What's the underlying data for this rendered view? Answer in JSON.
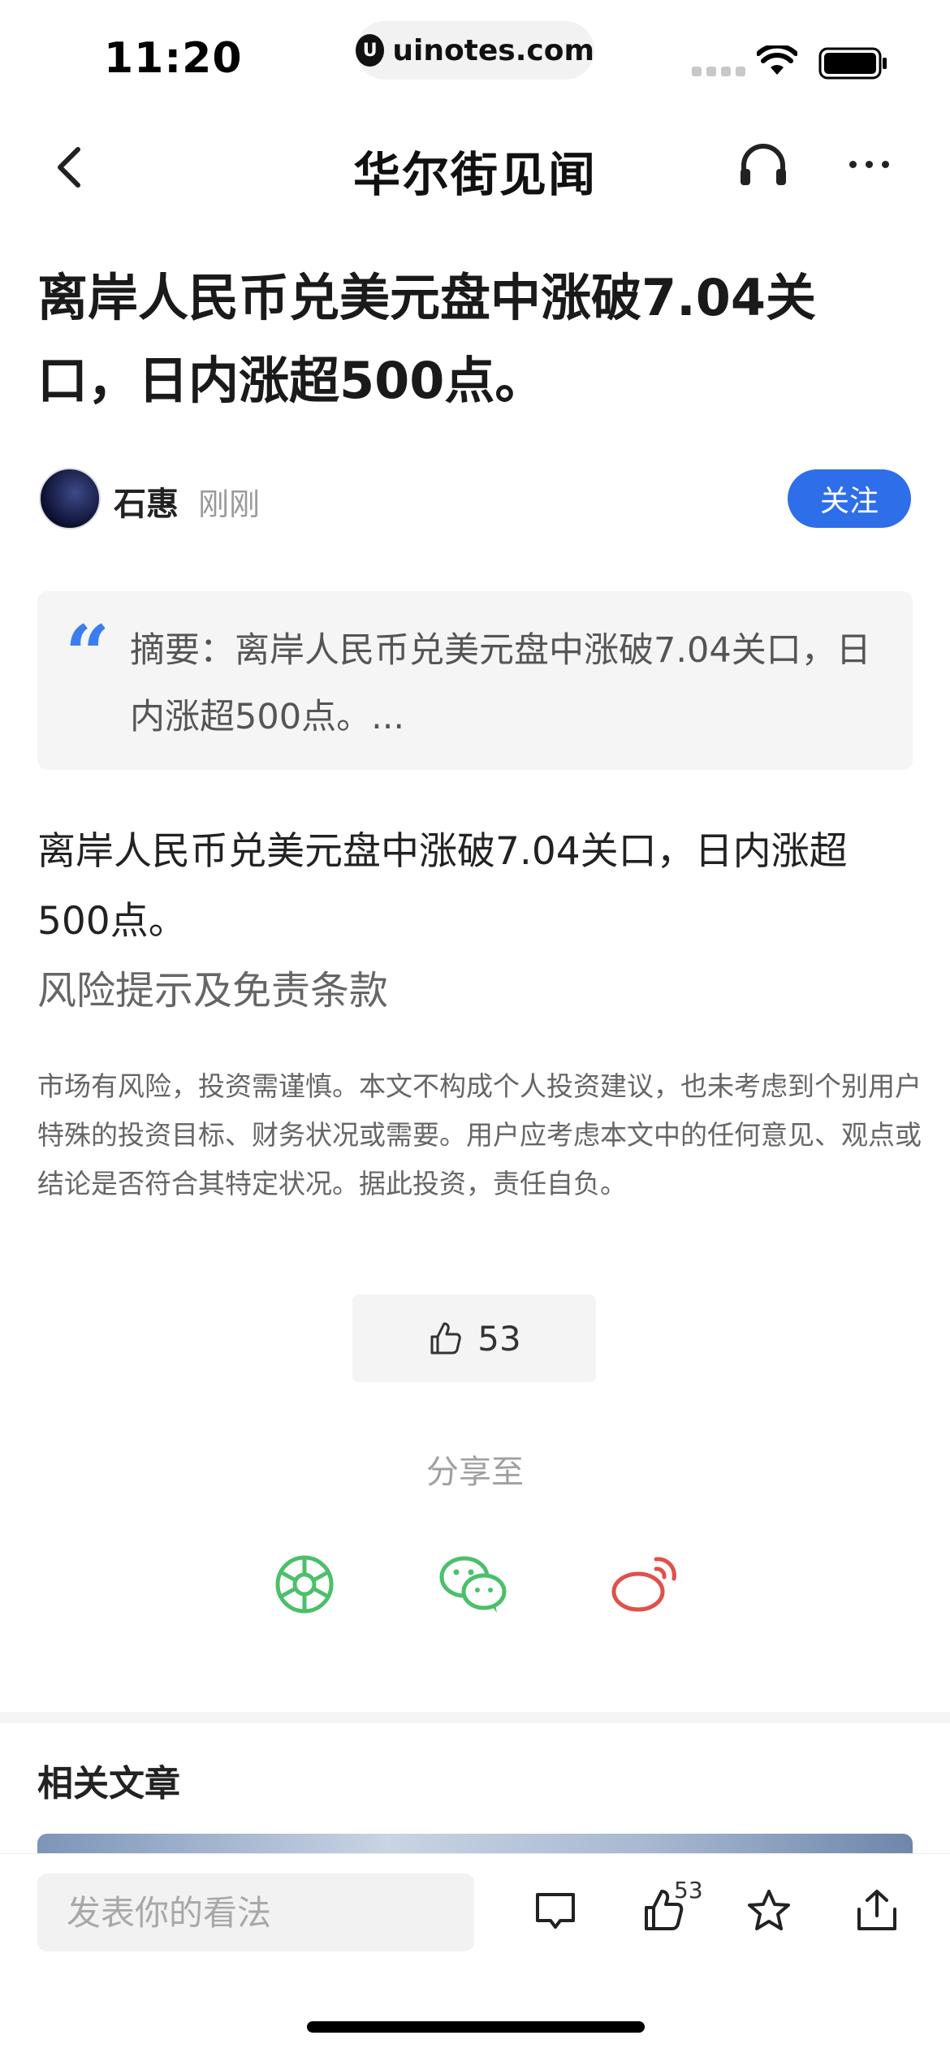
{
  "status": {
    "time": "11:20",
    "url": "uinotes.com",
    "url_logo": "U"
  },
  "nav": {
    "brand": "华尔街见闻",
    "back_icon": "chevron-left-icon",
    "audio_icon": "headphones-icon",
    "more_icon": "more-icon"
  },
  "article": {
    "title": "离岸人民币兑美元盘中涨破7.04关口，日内涨超500点。",
    "author": "石惠",
    "time": "刚刚",
    "follow_label": "关注",
    "summary_mark": "“",
    "summary": "摘要：离岸人民币兑美元盘中涨破7.04关口，日内涨超500点。...",
    "body": "离岸人民币兑美元盘中涨破7.04关口，日内涨超500点。",
    "risk_title": "风险提示及免责条款",
    "disclaimer": "市场有风险，投资需谨慎。本文不构成个人投资建议，也未考虑到个别用户特殊的投资目标、财务状况或需要。用户应考虑本文中的任何意见、观点或结论是否符合其特定状况。据此投资，责任自负。"
  },
  "likes": {
    "count": "53"
  },
  "share": {
    "label": "分享至",
    "targets": [
      {
        "icon": "moments-icon",
        "color": "#4cbf6b"
      },
      {
        "icon": "wechat-icon",
        "color": "#4cbf6b"
      },
      {
        "icon": "weibo-icon",
        "color": "#e0514b"
      }
    ]
  },
  "related": {
    "title": "相关文章"
  },
  "bottom_bar": {
    "comment_placeholder": "发表你的看法",
    "like_count": "53"
  },
  "colors": {
    "accent": "#2e6ee8",
    "quote": "#3b7ded",
    "share_green": "#4cbf6b",
    "share_red": "#e0514b"
  }
}
